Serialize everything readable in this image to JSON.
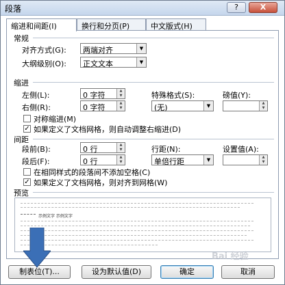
{
  "dialog": {
    "title": "段落",
    "help_label": "?",
    "close_label": "X"
  },
  "tabs": [
    {
      "label": "缩进和间距(I)",
      "active": true
    },
    {
      "label": "换行和分页(P)",
      "active": false
    },
    {
      "label": "中文版式(H)",
      "active": false
    }
  ],
  "general": {
    "section_label": "常规",
    "alignment_label": "对齐方式(G):",
    "alignment_value": "两端对齐",
    "outline_label": "大纲级别(O):",
    "outline_value": "正文文本"
  },
  "indent": {
    "section_label": "缩进",
    "left_label": "左侧(L):",
    "left_value": "0 字符",
    "right_label": "右侧(R):",
    "right_value": "0 字符",
    "special_label": "特殊格式(S):",
    "special_value": "(无)",
    "by_label": "磅值(Y):",
    "by_value": "",
    "mirror_label": "对称缩进(M)",
    "mirror_checked": false,
    "auto_adjust_label": "如果定义了文档网格，则自动调整右缩进(D)",
    "auto_adjust_checked": true
  },
  "spacing": {
    "section_label": "间距",
    "before_label": "段前(B):",
    "before_value": "0 行",
    "after_label": "段后(F):",
    "after_value": "0 行",
    "line_label": "行距(N):",
    "line_value": "单倍行距",
    "at_label": "设置值(A):",
    "at_value": "",
    "no_space_label": "在相同样式的段落间不添加空格(C)",
    "no_space_checked": false,
    "snap_grid_label": "如果定义了文档网格，则对齐到网格(W)",
    "snap_grid_checked": true
  },
  "preview": {
    "label": "预览",
    "sample_text": "示例文字 示例文字"
  },
  "buttons": {
    "tabs": "制表位(T)...",
    "set_default": "设为默认值(D)",
    "ok": "确定",
    "cancel": "取消"
  },
  "watermark": "Bai 经验",
  "colors": {
    "arrow": "#3b6fb6",
    "panel_border": "#8e9bb0",
    "title_bar": "#c5d6ec"
  }
}
